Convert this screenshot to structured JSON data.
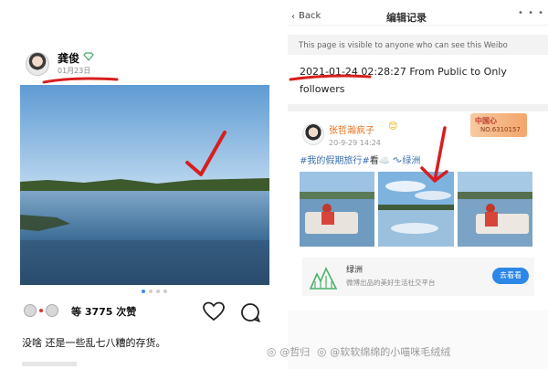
{
  "left_post": {
    "username": "龚俊",
    "date": "01月23日",
    "like_count": "等 3775 次赞",
    "caption": "没啥 还是一些乱七八糟的存货。"
  },
  "right_record": {
    "header": {
      "back_label": "Back",
      "title": "编辑记录"
    },
    "visibility_notice": "This page is visible to anyone who can see this Weibo",
    "record_line1": "2021-01-24 02:28:27 From Public to Only",
    "record_line2": "followers",
    "weibo_post": {
      "author": "张哲瀚疯子",
      "author_emoji": "😊",
      "date": "20-9-29 14:24",
      "text_tag": "#我的假期旅行#",
      "text_plain": "看",
      "text_emoji": "☁️",
      "location": "绿洲",
      "badge_title": "中国心",
      "badge_number": "NO.6310157"
    },
    "oasis_card": {
      "name": "绿洲",
      "subtitle": "微博出品的美好生活社交平台",
      "button": "去看看"
    }
  },
  "watermark": {
    "user1": "@哲归",
    "user2": "@软软绵绵的小喵咪毛绒绒"
  },
  "colors": {
    "annotation_red": "#d81e1e",
    "weibo_orange": "#e8711a",
    "link_blue": "#3b6fb0",
    "button_blue": "#2d87e6"
  }
}
